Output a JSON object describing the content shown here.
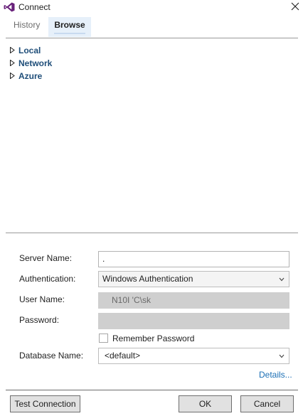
{
  "window": {
    "title": "Connect",
    "app_icon": "visual-studio-icon",
    "close_icon": "close-icon"
  },
  "tabs": [
    {
      "label": "History",
      "selected": false
    },
    {
      "label": "Browse",
      "selected": true
    }
  ],
  "tree": {
    "items": [
      {
        "label": "Local"
      },
      {
        "label": "Network"
      },
      {
        "label": "Azure"
      }
    ]
  },
  "form": {
    "server_name": {
      "label": "Server Name:",
      "value": "."
    },
    "authentication": {
      "label": "Authentication:",
      "value": "Windows Authentication"
    },
    "user_name": {
      "label": "User Name:",
      "value": "N10I    'C\\sk"
    },
    "password": {
      "label": "Password:",
      "value": ""
    },
    "remember_password": {
      "label": "Remember Password",
      "checked": false
    },
    "database_name": {
      "label": "Database Name:",
      "value": "<default>"
    },
    "details_link": "Details..."
  },
  "buttons": {
    "test_connection": "Test Connection",
    "ok": "OK",
    "cancel": "Cancel"
  },
  "colors": {
    "accent_blue": "#1f4e79",
    "link_blue": "#1b6fb5",
    "tab_selected_bg": "#e6f0fa",
    "vs_purple": "#68217a"
  }
}
